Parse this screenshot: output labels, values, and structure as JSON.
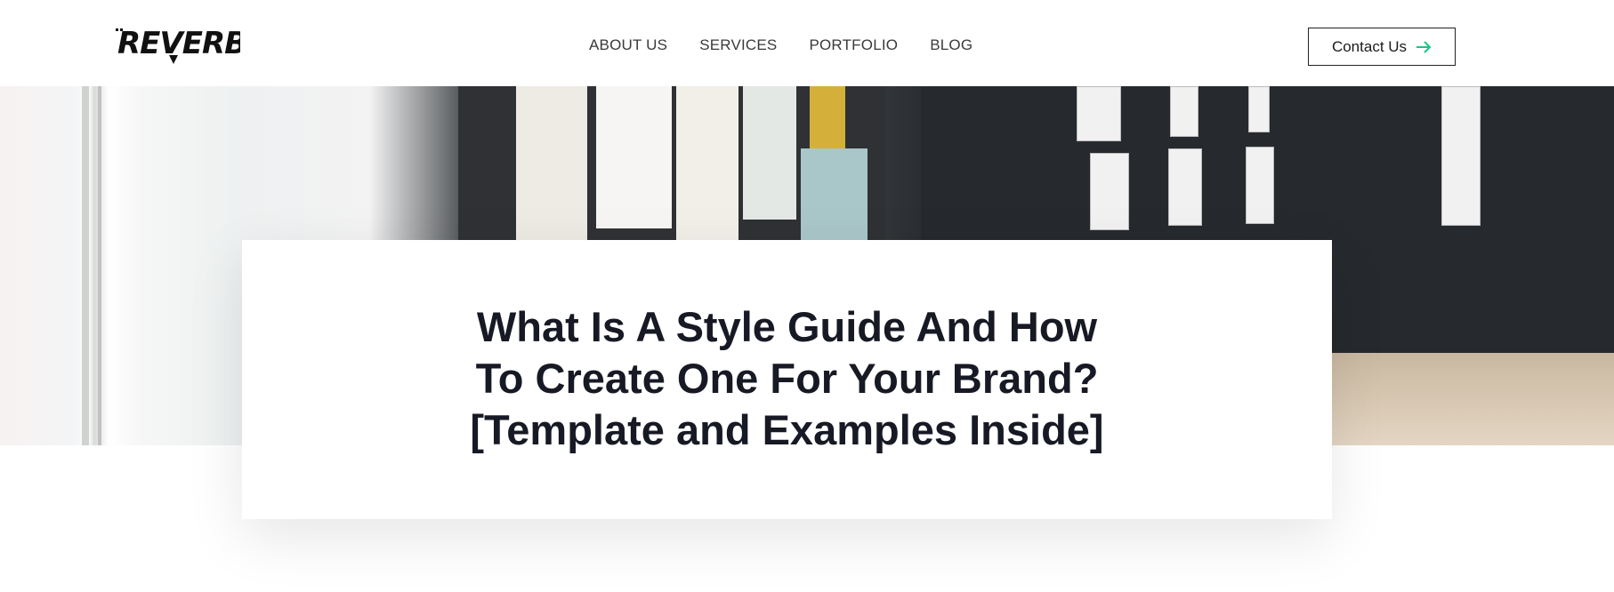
{
  "header": {
    "logo_text": "REVERB",
    "nav": [
      "ABOUT US",
      "SERVICES",
      "PORTFOLIO",
      "BLOG"
    ],
    "contact_label": "Contact Us",
    "accent_color": "#16c784"
  },
  "hero": {
    "title_lines": [
      "What Is A Style Guide And How",
      "To Create One For Your Brand?",
      "[Template and Examples Inside]"
    ]
  }
}
